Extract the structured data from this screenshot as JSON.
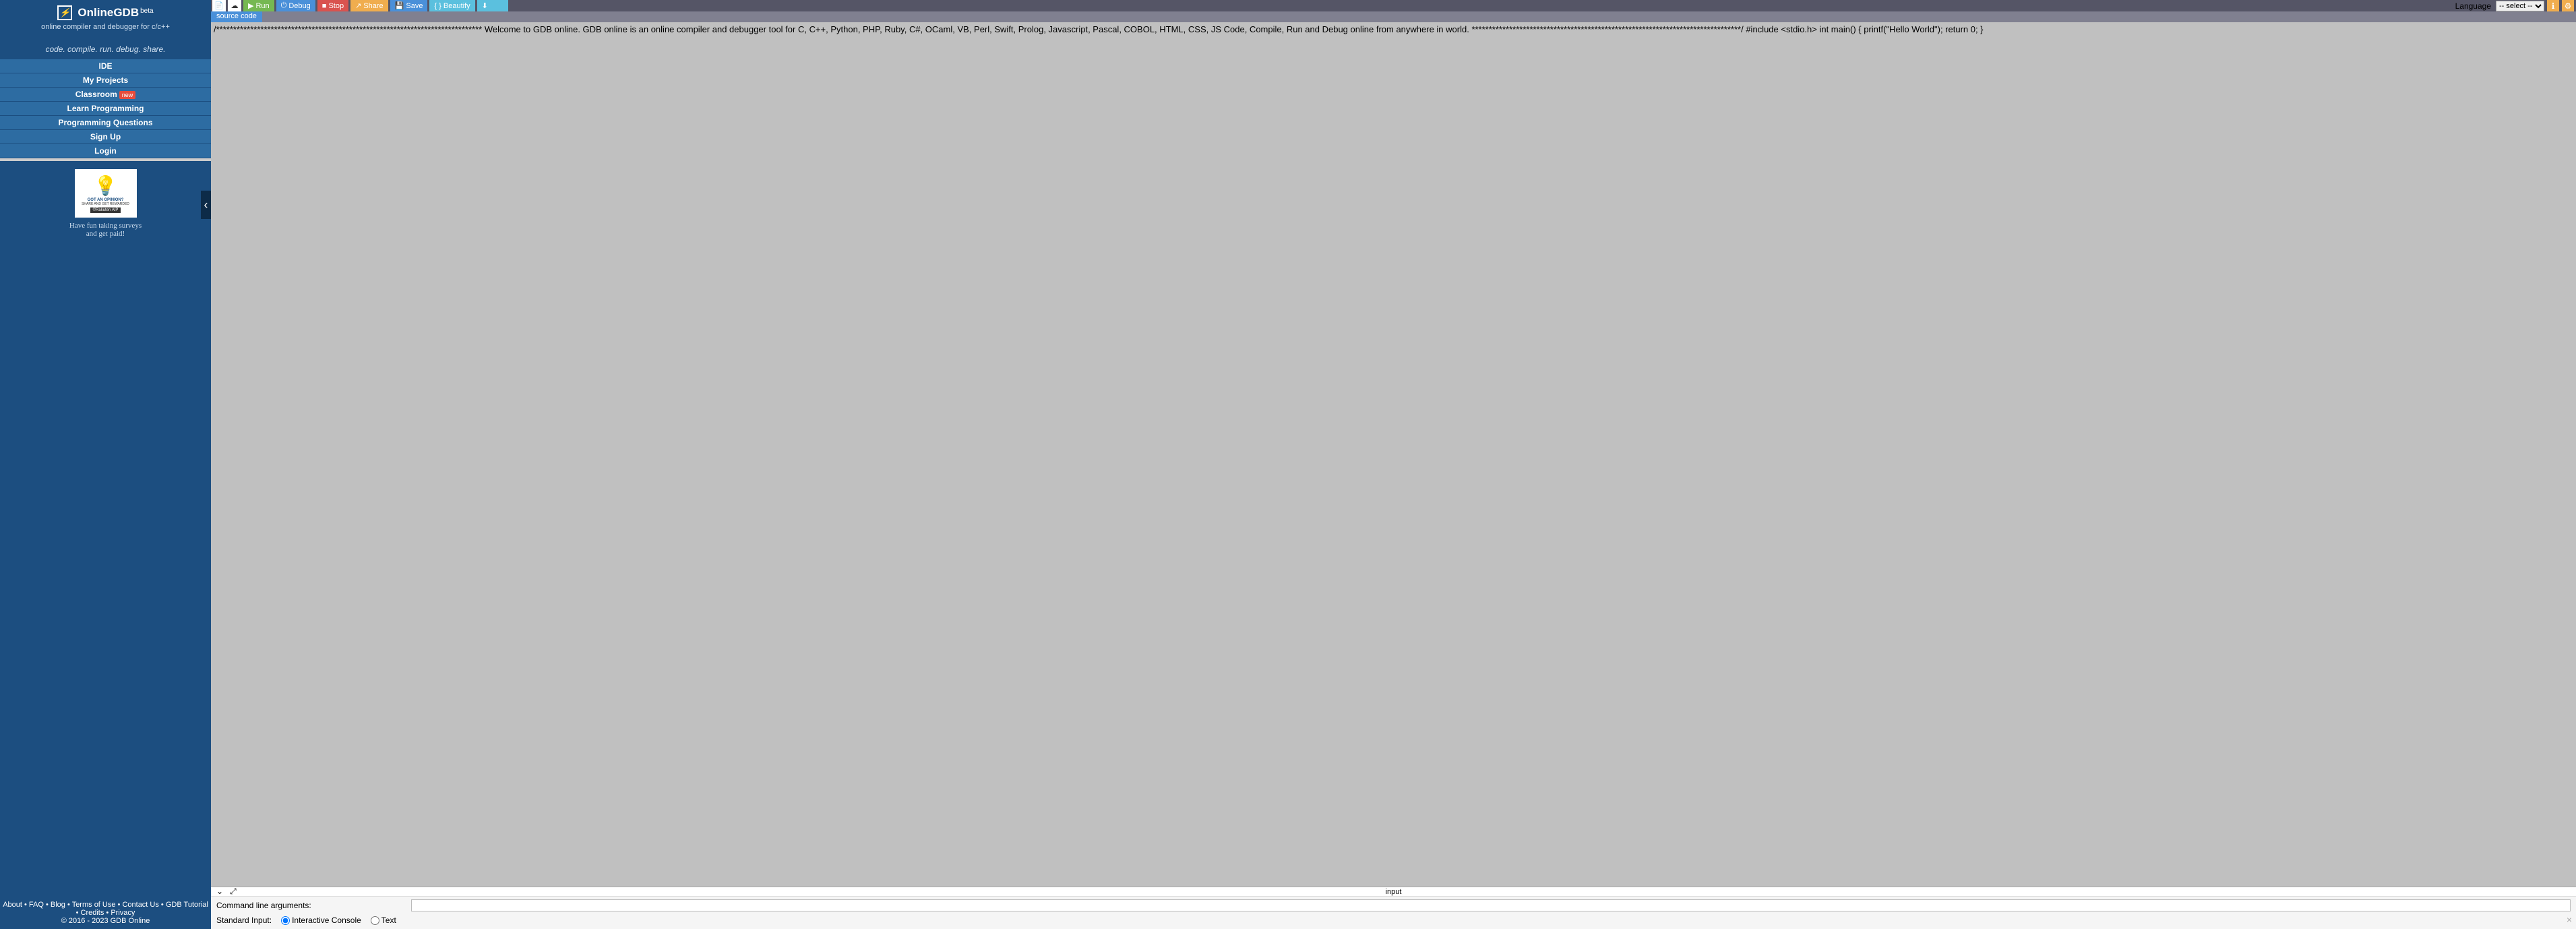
{
  "sidebar": {
    "title": "OnlineGDB",
    "beta": "beta",
    "subtitle": "online compiler and debugger for c/c++",
    "tagline": "code. compile. run. debug. share.",
    "nav": [
      "IDE",
      "My Projects",
      "Classroom",
      "Learn Programming",
      "Programming Questions",
      "Sign Up",
      "Login"
    ],
    "new_badge": "new",
    "ad": {
      "line1": "GOT AN OPINION?",
      "line2": "SHARE AND GET REWARDED",
      "brand": "©Rakuten AIP",
      "caption1": "Have fun taking surveys",
      "caption2": "and get paid!"
    },
    "footer_links": [
      "About",
      "FAQ",
      "Blog",
      "Terms of Use",
      "Contact Us",
      "GDB Tutorial",
      "Credits",
      "Privacy"
    ],
    "copyright": "© 2016 - 2023 GDB Online"
  },
  "toolbar": {
    "run": "Run",
    "debug": "Debug",
    "stop": "Stop",
    "share": "Share",
    "save": "Save",
    "beautify": "{ } Beautify",
    "language_label": "Language",
    "language_selected": "-- select --"
  },
  "tabs": {
    "source": "source code"
  },
  "editor": {
    "content": "/****************************************************************************** Welcome to GDB online. GDB online is an online compiler and debugger tool for C, C++, Python, PHP, Ruby, C#, OCaml, VB, Perl, Swift, Prolog, Javascript, Pascal, COBOL, HTML, CSS, JS Code, Compile, Run and Debug online from anywhere in world. *******************************************************************************/ #include <stdio.h> int main() { printf(\"Hello World\"); return 0; }"
  },
  "io": {
    "input_label": "input",
    "cmd_label": "Command line arguments:",
    "stdin_label": "Standard Input:",
    "opt_interactive": "Interactive Console",
    "opt_text": "Text"
  }
}
